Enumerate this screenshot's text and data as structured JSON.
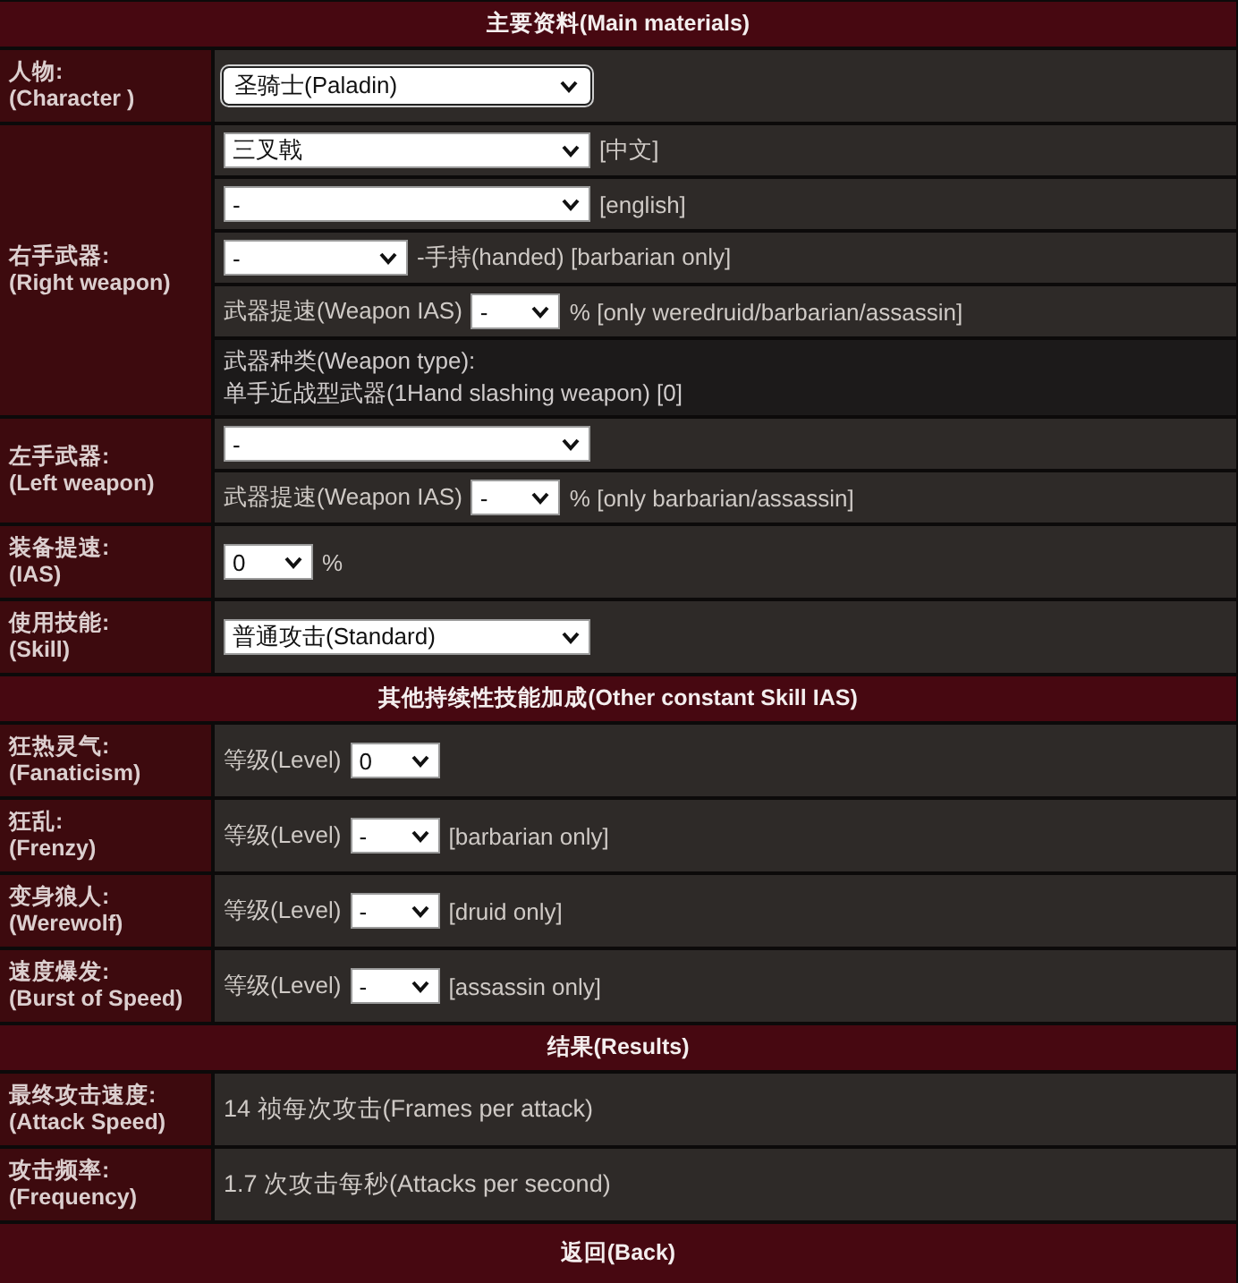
{
  "sections": [
    {
      "kind": "header",
      "title": "主要资料(Main materials)"
    },
    {
      "kind": "field",
      "label": "人物:",
      "label_en": "(Character )",
      "cells": [
        {
          "kind": "controls",
          "parts": [
            {
              "kind": "select-long",
              "value": "圣骑士(Paladin)",
              "focused": true
            }
          ]
        }
      ]
    },
    {
      "kind": "field",
      "label": "右手武器:",
      "label_en": "(Right weapon)",
      "cells": [
        {
          "kind": "controls",
          "parts": [
            {
              "kind": "select-long",
              "value": "三叉戟",
              "focused": false
            },
            {
              "kind": "text",
              "text": "[中文]"
            }
          ]
        },
        {
          "kind": "controls",
          "parts": [
            {
              "kind": "select-long",
              "value": "-",
              "focused": false
            },
            {
              "kind": "text",
              "text": "[english]"
            }
          ]
        },
        {
          "kind": "controls",
          "parts": [
            {
              "kind": "select-medium",
              "value": "-",
              "focused": false
            },
            {
              "kind": "text",
              "text": "-手持(handed) [barbarian only]"
            }
          ]
        },
        {
          "kind": "controls",
          "parts": [
            {
              "kind": "text",
              "text": "武器提速(Weapon IAS)"
            },
            {
              "kind": "select-short",
              "value": "-",
              "focused": false
            },
            {
              "kind": "text",
              "text": "% [only weredruid/barbarian/assassin]"
            }
          ]
        },
        {
          "kind": "note",
          "lines": [
            "武器种类(Weapon type):",
            "单手近战型武器(1Hand slashing weapon) [0]"
          ]
        }
      ]
    },
    {
      "kind": "field",
      "label": "左手武器:",
      "label_en": "(Left weapon)",
      "cells": [
        {
          "kind": "controls",
          "parts": [
            {
              "kind": "select-long",
              "value": "-",
              "focused": false
            }
          ]
        },
        {
          "kind": "controls",
          "parts": [
            {
              "kind": "text",
              "text": "武器提速(Weapon IAS)"
            },
            {
              "kind": "select-short",
              "value": "-",
              "focused": false
            },
            {
              "kind": "text",
              "text": "% [only barbarian/assassin]"
            }
          ]
        }
      ]
    },
    {
      "kind": "field",
      "label": "装备提速:",
      "label_en": "(IAS)",
      "cells": [
        {
          "kind": "controls",
          "parts": [
            {
              "kind": "select-short",
              "value": "0",
              "focused": false
            },
            {
              "kind": "text",
              "text": "%"
            }
          ]
        }
      ]
    },
    {
      "kind": "field",
      "label": "使用技能:",
      "label_en": "(Skill)",
      "cells": [
        {
          "kind": "controls",
          "parts": [
            {
              "kind": "select-long",
              "value": "普通攻击(Standard)",
              "focused": false
            }
          ]
        }
      ]
    },
    {
      "kind": "header",
      "title": "其他持续性技能加成(Other constant Skill IAS)"
    },
    {
      "kind": "field",
      "label": "狂热灵气:",
      "label_en": "(Fanaticism)",
      "cells": [
        {
          "kind": "controls",
          "parts": [
            {
              "kind": "text",
              "text": "等级(Level)"
            },
            {
              "kind": "select-short",
              "value": "0",
              "focused": false
            }
          ]
        }
      ]
    },
    {
      "kind": "field",
      "label": "狂乱:",
      "label_en": "(Frenzy)",
      "cells": [
        {
          "kind": "controls",
          "parts": [
            {
              "kind": "text",
              "text": "等级(Level)"
            },
            {
              "kind": "select-short",
              "value": "-",
              "focused": false
            },
            {
              "kind": "text",
              "text": "[barbarian only]"
            }
          ]
        }
      ]
    },
    {
      "kind": "field",
      "label": "变身狼人:",
      "label_en": "(Werewolf)",
      "cells": [
        {
          "kind": "controls",
          "parts": [
            {
              "kind": "text",
              "text": "等级(Level)"
            },
            {
              "kind": "select-short",
              "value": "-",
              "focused": false
            },
            {
              "kind": "text",
              "text": "[druid only]"
            }
          ]
        }
      ]
    },
    {
      "kind": "field",
      "label": "速度爆发:",
      "label_en": "(Burst of Speed)",
      "cells": [
        {
          "kind": "controls",
          "parts": [
            {
              "kind": "text",
              "text": "等级(Level)"
            },
            {
              "kind": "select-short",
              "value": "-",
              "focused": false
            },
            {
              "kind": "text",
              "text": "[assassin only]"
            }
          ]
        }
      ]
    },
    {
      "kind": "header",
      "title": "结果(Results)"
    },
    {
      "kind": "field",
      "label": "最终攻击速度:",
      "label_en": "(Attack Speed)",
      "cells": [
        {
          "kind": "result",
          "text": "14 祯每次攻击(Frames per attack)"
        }
      ]
    },
    {
      "kind": "field",
      "label": "攻击频率:",
      "label_en": "(Frequency)",
      "cells": [
        {
          "kind": "result",
          "text": "1.7 次攻击每秒(Attacks per second)"
        }
      ]
    },
    {
      "kind": "back",
      "title": "返回(Back)"
    }
  ]
}
